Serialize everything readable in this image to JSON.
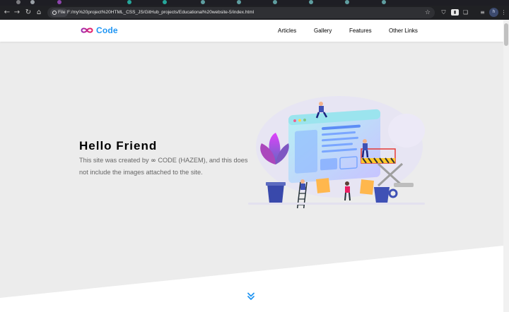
{
  "browser": {
    "file_chip": "File",
    "url": "F:/my%20project%20HTML_CSS_JS/GitHub_projects/Educational%20website-5/index.html",
    "profile_initial": "h"
  },
  "site": {
    "logo_text": "Code",
    "logo_color": "#2196f3",
    "logo_gradient": [
      "#9c27b0",
      "#e91e63"
    ],
    "nav": [
      "Articles",
      "Gallery",
      "Features",
      "Other Links"
    ]
  },
  "hero": {
    "title": "Hello Friend",
    "text_before": "This site was created by",
    "infinity_glyph": "∞",
    "text_after": "CODE (HAZEM), and this does not include the images attached to the site."
  },
  "accent_color": "#2196f3",
  "icons": {
    "scroll_down": "double-chevron-down-icon"
  }
}
